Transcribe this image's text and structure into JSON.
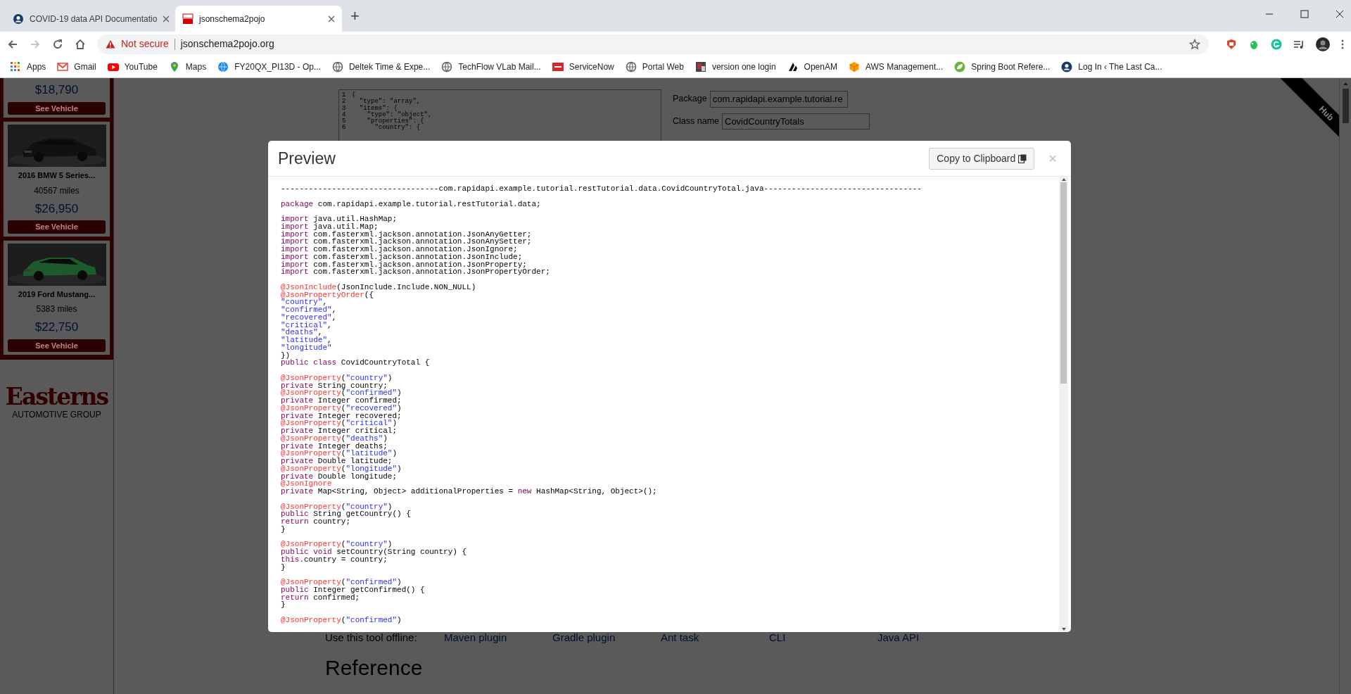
{
  "browser": {
    "tabs": [
      {
        "title": "COVID-19 data API Documentatio",
        "selected": false
      },
      {
        "title": "jsonschema2pojo",
        "selected": true
      }
    ],
    "new_tab": "+",
    "security": "Not secure",
    "url": "jsonschema2pojo.org",
    "bookmarks": [
      {
        "label": "Apps"
      },
      {
        "label": "Gmail"
      },
      {
        "label": "YouTube"
      },
      {
        "label": "Maps"
      },
      {
        "label": "FY20QX_PI13D - Op..."
      },
      {
        "label": "Deltek Time & Expe..."
      },
      {
        "label": "TechFlow VLab Mail..."
      },
      {
        "label": "ServiceNow"
      },
      {
        "label": "Portal Web"
      },
      {
        "label": "version one login"
      },
      {
        "label": "OpenAM"
      },
      {
        "label": "AWS Management..."
      },
      {
        "label": "Spring Boot Refere..."
      },
      {
        "label": "Log In ‹ The Last Ca..."
      }
    ]
  },
  "page": {
    "ads": [
      {
        "price": "$18,790",
        "button": "See Vehicle"
      },
      {
        "model": "2016 BMW 5 Series...",
        "mileage": "40567 miles",
        "price": "$26,950",
        "button": "See Vehicle"
      },
      {
        "model": "2019 Ford Mustang...",
        "mileage": "5383 miles",
        "price": "$22,750",
        "button": "See Vehicle"
      }
    ],
    "logo": {
      "name": "Easterns",
      "tagline": "AUTOMOTIVE GROUP"
    },
    "schema_lines": [
      {
        "number": "1",
        "text": "{"
      },
      {
        "number": "2",
        "text": "  \"type\": \"array\","
      },
      {
        "number": "3",
        "text": "  \"items\": {"
      },
      {
        "number": "4",
        "text": "    \"type\": \"object\","
      },
      {
        "number": "5",
        "text": "    \"properties\": {"
      },
      {
        "number": "6",
        "text": "      \"country\": {"
      }
    ],
    "package": {
      "label": "Package",
      "value": "com.rapidapi.example.tutorial.re"
    },
    "class_name": {
      "label": "Class name",
      "value": "CovidCountryTotals"
    },
    "ribbon": "Hub",
    "offline": {
      "label": "Use this tool offline:",
      "links": [
        "Maven plugin",
        "Gradle plugin",
        "Ant task",
        "CLI",
        "Java API"
      ]
    },
    "reference_heading": "Reference"
  },
  "modal": {
    "title": "Preview",
    "copy_button": "Copy to Clipboard",
    "close": "×",
    "code_lines": [
      {
        "kind": "code",
        "tokens": [
          {
            "kind": "plain",
            "text": "----------------------------------com.rapidapi.example.tutorial.restTutorial.data.CovidCountryTotal.java----------------------------------"
          }
        ]
      },
      {
        "kind": "blank"
      },
      {
        "kind": "code",
        "tokens": [
          {
            "kind": "keyword",
            "text": "package"
          },
          {
            "kind": "plain",
            "text": " com.rapidapi.example.tutorial.restTutorial.data;"
          }
        ]
      },
      {
        "kind": "blank"
      },
      {
        "kind": "code",
        "tokens": [
          {
            "kind": "keyword",
            "text": "import"
          },
          {
            "kind": "plain",
            "text": " java.util.HashMap;"
          }
        ]
      },
      {
        "kind": "code",
        "tokens": [
          {
            "kind": "keyword",
            "text": "import"
          },
          {
            "kind": "plain",
            "text": " java.util.Map;"
          }
        ]
      },
      {
        "kind": "code",
        "tokens": [
          {
            "kind": "keyword",
            "text": "import"
          },
          {
            "kind": "plain",
            "text": " com.fasterxml.jackson.annotation.JsonAnyGetter;"
          }
        ]
      },
      {
        "kind": "code",
        "tokens": [
          {
            "kind": "keyword",
            "text": "import"
          },
          {
            "kind": "plain",
            "text": " com.fasterxml.jackson.annotation.JsonAnySetter;"
          }
        ]
      },
      {
        "kind": "code",
        "tokens": [
          {
            "kind": "keyword",
            "text": "import"
          },
          {
            "kind": "plain",
            "text": " com.fasterxml.jackson.annotation.JsonIgnore;"
          }
        ]
      },
      {
        "kind": "code",
        "tokens": [
          {
            "kind": "keyword",
            "text": "import"
          },
          {
            "kind": "plain",
            "text": " com.fasterxml.jackson.annotation.JsonInclude;"
          }
        ]
      },
      {
        "kind": "code",
        "tokens": [
          {
            "kind": "keyword",
            "text": "import"
          },
          {
            "kind": "plain",
            "text": " com.fasterxml.jackson.annotation.JsonProperty;"
          }
        ]
      },
      {
        "kind": "code",
        "tokens": [
          {
            "kind": "keyword",
            "text": "import"
          },
          {
            "kind": "plain",
            "text": " com.fasterxml.jackson.annotation.JsonPropertyOrder;"
          }
        ]
      },
      {
        "kind": "blank"
      },
      {
        "kind": "code",
        "tokens": [
          {
            "kind": "annotation",
            "text": "@JsonInclude"
          },
          {
            "kind": "plain",
            "text": "(JsonInclude.Include.NON_NULL)"
          }
        ]
      },
      {
        "kind": "code",
        "tokens": [
          {
            "kind": "annotation",
            "text": "@JsonPropertyOrder"
          },
          {
            "kind": "plain",
            "text": "({"
          }
        ]
      },
      {
        "kind": "code",
        "tokens": [
          {
            "kind": "string",
            "text": "\"country\""
          },
          {
            "kind": "plain",
            "text": ","
          }
        ]
      },
      {
        "kind": "code",
        "tokens": [
          {
            "kind": "string",
            "text": "\"confirmed\""
          },
          {
            "kind": "plain",
            "text": ","
          }
        ]
      },
      {
        "kind": "code",
        "tokens": [
          {
            "kind": "string",
            "text": "\"recovered\""
          },
          {
            "kind": "plain",
            "text": ","
          }
        ]
      },
      {
        "kind": "code",
        "tokens": [
          {
            "kind": "string",
            "text": "\"critical\""
          },
          {
            "kind": "plain",
            "text": ","
          }
        ]
      },
      {
        "kind": "code",
        "tokens": [
          {
            "kind": "string",
            "text": "\"deaths\""
          },
          {
            "kind": "plain",
            "text": ","
          }
        ]
      },
      {
        "kind": "code",
        "tokens": [
          {
            "kind": "string",
            "text": "\"latitude\""
          },
          {
            "kind": "plain",
            "text": ","
          }
        ]
      },
      {
        "kind": "code",
        "tokens": [
          {
            "kind": "string",
            "text": "\"longitude\""
          }
        ]
      },
      {
        "kind": "code",
        "tokens": [
          {
            "kind": "plain",
            "text": "})"
          }
        ]
      },
      {
        "kind": "code",
        "tokens": [
          {
            "kind": "keyword",
            "text": "public class"
          },
          {
            "kind": "plain",
            "text": " CovidCountryTotal {"
          }
        ]
      },
      {
        "kind": "blank"
      },
      {
        "kind": "code",
        "tokens": [
          {
            "kind": "annotation",
            "text": "@JsonProperty"
          },
          {
            "kind": "plain",
            "text": "("
          },
          {
            "kind": "string",
            "text": "\"country\""
          },
          {
            "kind": "plain",
            "text": ")"
          }
        ]
      },
      {
        "kind": "code",
        "tokens": [
          {
            "kind": "keyword",
            "text": "private"
          },
          {
            "kind": "plain",
            "text": " String country;"
          }
        ]
      },
      {
        "kind": "code",
        "tokens": [
          {
            "kind": "annotation",
            "text": "@JsonProperty"
          },
          {
            "kind": "plain",
            "text": "("
          },
          {
            "kind": "string",
            "text": "\"confirmed\""
          },
          {
            "kind": "plain",
            "text": ")"
          }
        ]
      },
      {
        "kind": "code",
        "tokens": [
          {
            "kind": "keyword",
            "text": "private"
          },
          {
            "kind": "plain",
            "text": " Integer confirmed;"
          }
        ]
      },
      {
        "kind": "code",
        "tokens": [
          {
            "kind": "annotation",
            "text": "@JsonProperty"
          },
          {
            "kind": "plain",
            "text": "("
          },
          {
            "kind": "string",
            "text": "\"recovered\""
          },
          {
            "kind": "plain",
            "text": ")"
          }
        ]
      },
      {
        "kind": "code",
        "tokens": [
          {
            "kind": "keyword",
            "text": "private"
          },
          {
            "kind": "plain",
            "text": " Integer recovered;"
          }
        ]
      },
      {
        "kind": "code",
        "tokens": [
          {
            "kind": "annotation",
            "text": "@JsonProperty"
          },
          {
            "kind": "plain",
            "text": "("
          },
          {
            "kind": "string",
            "text": "\"critical\""
          },
          {
            "kind": "plain",
            "text": ")"
          }
        ]
      },
      {
        "kind": "code",
        "tokens": [
          {
            "kind": "keyword",
            "text": "private"
          },
          {
            "kind": "plain",
            "text": " Integer critical;"
          }
        ]
      },
      {
        "kind": "code",
        "tokens": [
          {
            "kind": "annotation",
            "text": "@JsonProperty"
          },
          {
            "kind": "plain",
            "text": "("
          },
          {
            "kind": "string",
            "text": "\"deaths\""
          },
          {
            "kind": "plain",
            "text": ")"
          }
        ]
      },
      {
        "kind": "code",
        "tokens": [
          {
            "kind": "keyword",
            "text": "private"
          },
          {
            "kind": "plain",
            "text": " Integer deaths;"
          }
        ]
      },
      {
        "kind": "code",
        "tokens": [
          {
            "kind": "annotation",
            "text": "@JsonProperty"
          },
          {
            "kind": "plain",
            "text": "("
          },
          {
            "kind": "string",
            "text": "\"latitude\""
          },
          {
            "kind": "plain",
            "text": ")"
          }
        ]
      },
      {
        "kind": "code",
        "tokens": [
          {
            "kind": "keyword",
            "text": "private"
          },
          {
            "kind": "plain",
            "text": " Double latitude;"
          }
        ]
      },
      {
        "kind": "code",
        "tokens": [
          {
            "kind": "annotation",
            "text": "@JsonProperty"
          },
          {
            "kind": "plain",
            "text": "("
          },
          {
            "kind": "string",
            "text": "\"longitude\""
          },
          {
            "kind": "plain",
            "text": ")"
          }
        ]
      },
      {
        "kind": "code",
        "tokens": [
          {
            "kind": "keyword",
            "text": "private"
          },
          {
            "kind": "plain",
            "text": " Double longitude;"
          }
        ]
      },
      {
        "kind": "code",
        "tokens": [
          {
            "kind": "annotation",
            "text": "@JsonIgnore"
          }
        ]
      },
      {
        "kind": "code",
        "tokens": [
          {
            "kind": "keyword",
            "text": "private"
          },
          {
            "kind": "plain",
            "text": " Map<String, Object> additionalProperties = "
          },
          {
            "kind": "keyword",
            "text": "new"
          },
          {
            "kind": "plain",
            "text": " HashMap<String, Object>();"
          }
        ]
      },
      {
        "kind": "blank"
      },
      {
        "kind": "code",
        "tokens": [
          {
            "kind": "annotation",
            "text": "@JsonProperty"
          },
          {
            "kind": "plain",
            "text": "("
          },
          {
            "kind": "string",
            "text": "\"country\""
          },
          {
            "kind": "plain",
            "text": ")"
          }
        ]
      },
      {
        "kind": "code",
        "tokens": [
          {
            "kind": "keyword",
            "text": "public"
          },
          {
            "kind": "plain",
            "text": " String getCountry() {"
          }
        ]
      },
      {
        "kind": "code",
        "tokens": [
          {
            "kind": "keyword",
            "text": "return"
          },
          {
            "kind": "plain",
            "text": " country;"
          }
        ]
      },
      {
        "kind": "code",
        "tokens": [
          {
            "kind": "plain",
            "text": "}"
          }
        ]
      },
      {
        "kind": "blank"
      },
      {
        "kind": "code",
        "tokens": [
          {
            "kind": "annotation",
            "text": "@JsonProperty"
          },
          {
            "kind": "plain",
            "text": "("
          },
          {
            "kind": "string",
            "text": "\"country\""
          },
          {
            "kind": "plain",
            "text": ")"
          }
        ]
      },
      {
        "kind": "code",
        "tokens": [
          {
            "kind": "keyword",
            "text": "public void"
          },
          {
            "kind": "plain",
            "text": " setCountry(String country) {"
          }
        ]
      },
      {
        "kind": "code",
        "tokens": [
          {
            "kind": "keyword",
            "text": "this"
          },
          {
            "kind": "plain",
            "text": ".country = country;"
          }
        ]
      },
      {
        "kind": "code",
        "tokens": [
          {
            "kind": "plain",
            "text": "}"
          }
        ]
      },
      {
        "kind": "blank"
      },
      {
        "kind": "code",
        "tokens": [
          {
            "kind": "annotation",
            "text": "@JsonProperty"
          },
          {
            "kind": "plain",
            "text": "("
          },
          {
            "kind": "string",
            "text": "\"confirmed\""
          },
          {
            "kind": "plain",
            "text": ")"
          }
        ]
      },
      {
        "kind": "code",
        "tokens": [
          {
            "kind": "keyword",
            "text": "public"
          },
          {
            "kind": "plain",
            "text": " Integer getConfirmed() {"
          }
        ]
      },
      {
        "kind": "code",
        "tokens": [
          {
            "kind": "keyword",
            "text": "return"
          },
          {
            "kind": "plain",
            "text": " confirmed;"
          }
        ]
      },
      {
        "kind": "code",
        "tokens": [
          {
            "kind": "plain",
            "text": "}"
          }
        ]
      },
      {
        "kind": "blank"
      },
      {
        "kind": "code",
        "tokens": [
          {
            "kind": "annotation",
            "text": "@JsonProperty"
          },
          {
            "kind": "plain",
            "text": "("
          },
          {
            "kind": "string",
            "text": "\"confirmed\""
          },
          {
            "kind": "plain",
            "text": ")"
          }
        ]
      }
    ]
  }
}
